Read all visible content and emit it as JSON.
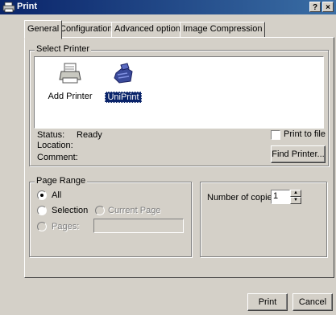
{
  "window": {
    "title": "Print",
    "help_label": "?",
    "close_label": "×"
  },
  "tabs": [
    {
      "label": "General"
    },
    {
      "label": "Configuration"
    },
    {
      "label": "Advanced options"
    },
    {
      "label": "Image Compression"
    }
  ],
  "select_printer": {
    "group_label": "Select Printer",
    "printers": [
      {
        "label": "Add Printer",
        "icon": "add-printer-icon"
      },
      {
        "label": "UniPrint",
        "icon": "uniprint-printer-icon"
      }
    ],
    "status_label": "Status:",
    "status_value": "Ready",
    "location_label": "Location:",
    "comment_label": "Comment:",
    "print_to_file_label": "Print to file",
    "find_printer_label": "Find Printer..."
  },
  "page_range": {
    "group_label": "Page Range",
    "all_label": "All",
    "selection_label": "Selection",
    "current_page_label": "Current Page",
    "pages_label": "Pages:",
    "pages_value": ""
  },
  "copies": {
    "label": "Number of copies:",
    "value": "1"
  },
  "footer": {
    "print_label": "Print",
    "cancel_label": "Cancel"
  }
}
